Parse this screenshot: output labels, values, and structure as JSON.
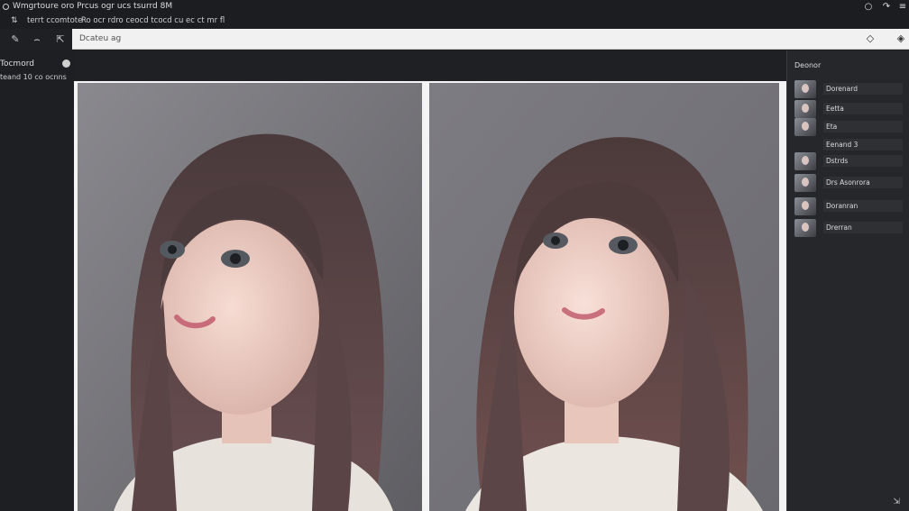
{
  "window": {
    "title": "Wmgrtoure oro Prcus ogr ucs tsurrd 8M",
    "controls": [
      "minimize-icon",
      "pin-icon",
      "menu-icon"
    ]
  },
  "menubar": {
    "icon": "brush-icon",
    "items": [
      {
        "label": "terrt ccomtote"
      },
      {
        "label": "Ro ocr rdro ceocd tcocd cu ec ct mr fl"
      }
    ]
  },
  "toolbar": {
    "tools": [
      "pencil-icon",
      "lasso-icon",
      "transform-icon"
    ]
  },
  "search": {
    "value": "Dcateu ag"
  },
  "left_panel": {
    "title": "Tocmord",
    "subtitle": "teand 10 co ocnns"
  },
  "right_panel": {
    "title": "Deonor",
    "layers": [
      {
        "label": "Dorenard"
      },
      {
        "label": "Eetta"
      },
      {
        "label": "Eta"
      },
      {
        "label": "Eenand 3"
      },
      {
        "label": "Dstrds"
      },
      {
        "label": "Drs Asonrora"
      },
      {
        "label": "Doranran"
      },
      {
        "label": "Drerran"
      }
    ]
  },
  "colors": {
    "app_bg": "#1f2023",
    "search_bg": "#f1f1f1",
    "panel_bg": "#26272a",
    "photo_bg": "#828187"
  }
}
